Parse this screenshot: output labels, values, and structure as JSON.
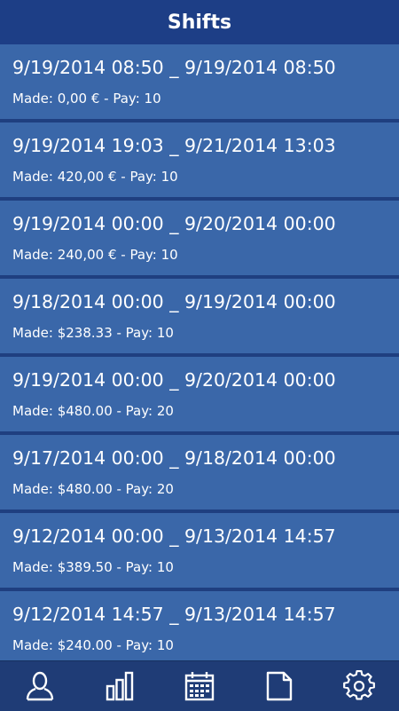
{
  "header": {
    "title": "Shifts"
  },
  "shifts": [
    {
      "range": "9/19/2014 08:50 _ 9/19/2014 08:50",
      "details": "Made: 0,00 € - Pay: 10"
    },
    {
      "range": "9/19/2014 19:03 _ 9/21/2014 13:03",
      "details": "Made: 420,00 € - Pay: 10"
    },
    {
      "range": "9/19/2014 00:00 _ 9/20/2014 00:00",
      "details": "Made: 240,00 € - Pay: 10"
    },
    {
      "range": "9/18/2014 00:00 _ 9/19/2014 00:00",
      "details": "Made: $238.33 - Pay: 10"
    },
    {
      "range": "9/19/2014 00:00 _ 9/20/2014 00:00",
      "details": "Made: $480.00 - Pay: 20"
    },
    {
      "range": "9/17/2014 00:00 _ 9/18/2014 00:00",
      "details": "Made: $480.00 - Pay: 20"
    },
    {
      "range": "9/12/2014 00:00 _ 9/13/2014 14:57",
      "details": "Made: $389.50 - Pay: 10"
    },
    {
      "range": "9/12/2014 14:57 _ 9/13/2014 14:57",
      "details": "Made: $240.00 - Pay: 10"
    }
  ],
  "tabs": [
    {
      "icon": "person-icon"
    },
    {
      "icon": "bar-chart-icon"
    },
    {
      "icon": "calendar-icon"
    },
    {
      "icon": "document-icon"
    },
    {
      "icon": "gear-icon"
    }
  ],
  "colors": {
    "header": "#1d3e86",
    "row": "#3a67a9",
    "separator": "#1f3f80",
    "tabbar": "#1f3c76",
    "text": "#ffffff"
  }
}
